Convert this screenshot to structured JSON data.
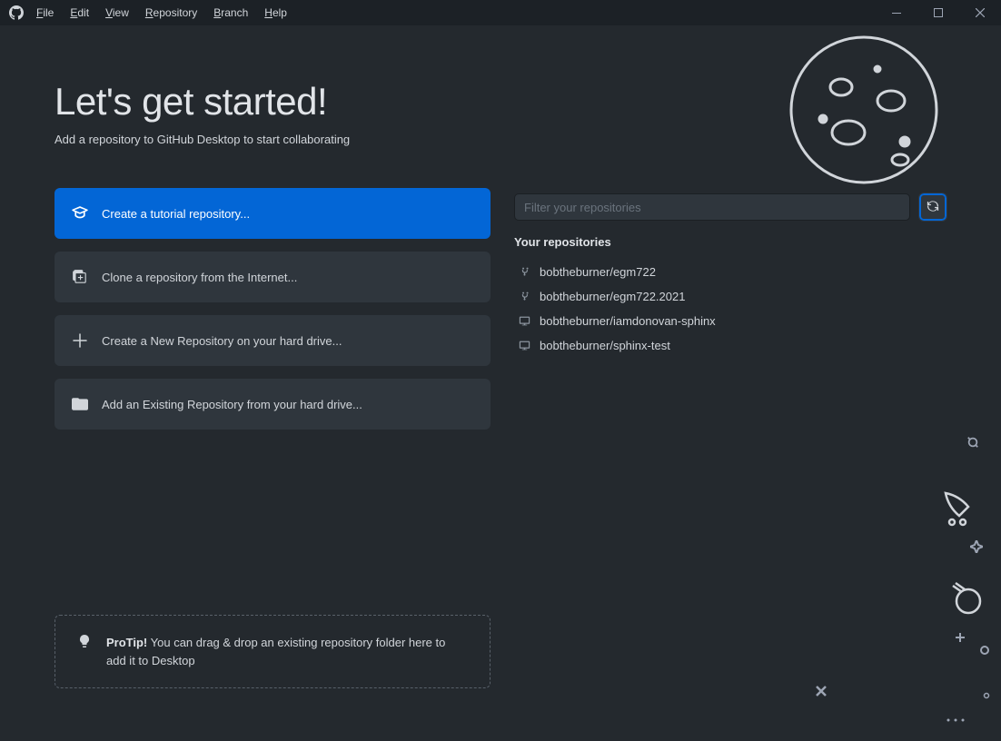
{
  "menu": {
    "file": "File",
    "edit": "Edit",
    "view": "View",
    "repository": "Repository",
    "branch": "Branch",
    "help": "Help"
  },
  "header": {
    "title": "Let's get started!",
    "subtitle": "Add a repository to GitHub Desktop to start collaborating"
  },
  "actions": {
    "tutorial": "Create a tutorial repository...",
    "clone": "Clone a repository from the Internet...",
    "create": "Create a New Repository on your hard drive...",
    "add": "Add an Existing Repository from your hard drive..."
  },
  "filter": {
    "placeholder": "Filter your repositories"
  },
  "repos": {
    "section_title": "Your repositories",
    "items": [
      {
        "name": "bobtheburner/egm722",
        "fork": true
      },
      {
        "name": "bobtheburner/egm722.2021",
        "fork": true
      },
      {
        "name": "bobtheburner/iamdonovan-sphinx",
        "fork": false
      },
      {
        "name": "bobtheburner/sphinx-test",
        "fork": false
      }
    ]
  },
  "protip": {
    "label": "ProTip!",
    "text": " You can drag & drop an existing repository folder here to add it to Desktop"
  }
}
